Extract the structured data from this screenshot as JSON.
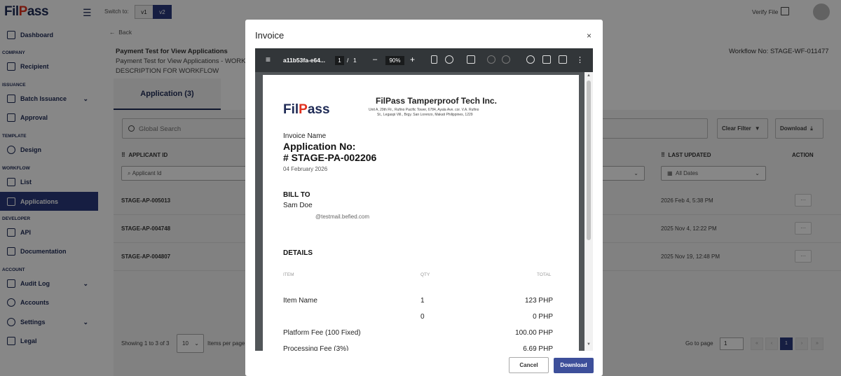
{
  "app": {
    "logo_prefix": "Fil",
    "logo_accent": "P",
    "logo_suffix": "ass"
  },
  "sidebar": {
    "dashboard": "Dashboard",
    "sections": {
      "company": "COMPANY",
      "issuance": "ISSUANCE",
      "template": "TEMPLATE",
      "workflow": "WORKFLOW",
      "developer": "DEVELOPER",
      "account": "ACCOUNT"
    },
    "items": {
      "recipient": "Recipient",
      "batch_issuance": "Batch Issuance",
      "approval": "Approval",
      "design": "Design",
      "list": "List",
      "applications": "Applications",
      "api": "API",
      "documentation": "Documentation",
      "audit_log": "Audit Log",
      "accounts": "Accounts",
      "settings": "Settings",
      "legal": "Legal"
    }
  },
  "topbar": {
    "switch_label": "Switch to:",
    "v1": "v1",
    "v2": "v2",
    "verify_file": "Verify File"
  },
  "main": {
    "back": "Back",
    "title": "Payment Test for View Applications",
    "description": "Payment Test for View Applications - WORK DESCRIPTION FOR WORKFLOW",
    "workflow_no": "Workflow No: STAGE-WF-011477",
    "tab_label": "Application (3)",
    "search_placeholder": "Global Search",
    "clear_filter": "Clear Filter",
    "download": "Download",
    "columns": {
      "applicant_id": "APPLICANT ID",
      "last_updated": "LAST UPDATED",
      "action": "ACTION"
    },
    "filters": {
      "applicant_id_placeholder": "Applicant Id",
      "all_dates": "All Dates"
    },
    "rows": [
      {
        "id": "STAGE-AP-005013",
        "last_updated": "2026 Feb 4, 5:38 PM",
        "action": "···"
      },
      {
        "id": "STAGE-AP-004748",
        "last_updated": "2025 Nov 4, 12:22 PM",
        "action": "···"
      },
      {
        "id": "STAGE-AP-004807",
        "last_updated": "2025 Nov 19, 12:48 PM",
        "action": "···"
      }
    ],
    "pagination": {
      "showing": "Showing 1 to 3 of 3",
      "per_page": "10",
      "items_per_page": "Items per page",
      "go_to_page": "Go to page",
      "page_value": "1",
      "current_page": "1",
      "first": "«",
      "prev": "‹",
      "next": "›",
      "last": "»"
    }
  },
  "modal": {
    "title": "Invoice",
    "close": "×",
    "cancel": "Cancel",
    "download": "Download",
    "viewer": {
      "filename": "a11b53fa-e64...",
      "page_current": "1",
      "page_sep": "/",
      "page_total": "1",
      "zoom": "90%",
      "minus": "–",
      "plus": "+",
      "menu": "≡",
      "more": "⋮"
    },
    "invoice": {
      "company": "FilPass Tamperproof Tech Inc.",
      "address_line1": "Unit A, 29th Flr., Rufino Pacific Tower, 6784, Ayala Ave. cor. V.A. Rufino",
      "address_line2": "St., Legaspi Vill., Brgy. San Lorenzo, Makati Philippines, 1229",
      "invoice_name": "Invoice Name",
      "app_no_label": "Application No:",
      "app_no": "# STAGE-PA-002206",
      "date": "04 February 2026",
      "bill_to": "BILL TO",
      "customer": "Sam Doe",
      "email": "@testmail.befied.com",
      "details": "DETAILS",
      "col_item": "ITEM",
      "col_qty": "QTY",
      "col_total": "TOTAL",
      "lines": [
        {
          "name": "Item Name",
          "qty": "1",
          "total": "123 PHP"
        },
        {
          "name": "",
          "qty": "0",
          "total": "0 PHP"
        },
        {
          "name": "Platform Fee (100  Fixed)",
          "qty": "",
          "total": "100.00 PHP"
        },
        {
          "name": "Processing Fee (3%)",
          "qty": "",
          "total": "6.69 PHP"
        }
      ]
    }
  },
  "colors": {
    "brand_navy": "#1e2a55",
    "active_nav": "#2b3a7e",
    "logo_accent": "#e0301e",
    "primary_button": "#3d4f9a"
  }
}
